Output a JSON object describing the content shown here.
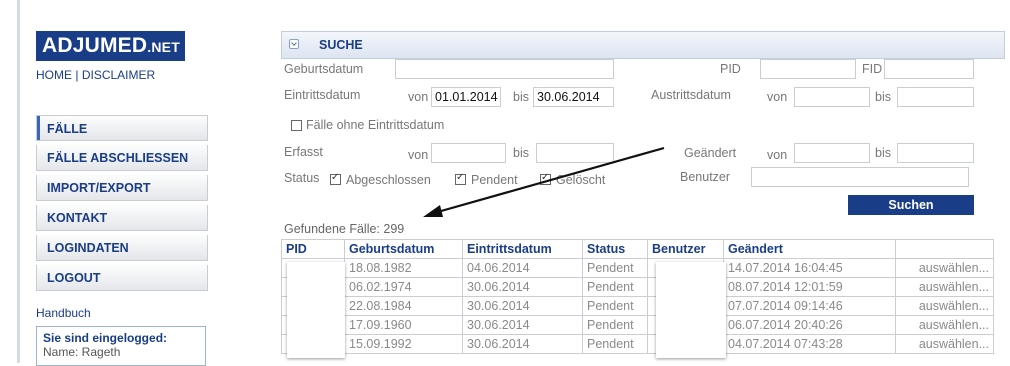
{
  "logo": {
    "main": "ADJUMED",
    "suffix": ".NET"
  },
  "toplinks": {
    "home": "HOME",
    "sep": "|",
    "disclaimer": "DISCLAIMER"
  },
  "nav": [
    "FÄLLE",
    "FÄLLE ABSCHLIESSEN",
    "IMPORT/EXPORT",
    "KONTAKT",
    "LOGINDATEN",
    "LOGOUT"
  ],
  "handbuch": "Handbuch",
  "login": {
    "title": "Sie sind eingelogged:",
    "name": "Name: Rageth"
  },
  "search": {
    "title": "SUCHE",
    "geburtsdatum_label": "Geburtsdatum",
    "pid_label": "PID",
    "fid_label": "FID",
    "eintrittsdatum_label": "Eintrittsdatum",
    "von": "von",
    "bis": "bis",
    "eintritt_von": "01.01.2014",
    "eintritt_bis": "30.06.2014",
    "austrittsdatum_label": "Austrittsdatum",
    "ohne_eintritt": "Fälle ohne Eintrittsdatum",
    "erfasst_label": "Erfasst",
    "geaendert_label": "Geändert",
    "status_label": "Status",
    "status_abgeschlossen": "Abgeschlossen",
    "status_pendent": "Pendent",
    "status_geloescht": "Gelöscht",
    "benutzer_label": "Benutzer",
    "submit": "Suchen"
  },
  "results": {
    "found_label": "Gefundene Fälle:",
    "found_count": "299",
    "headers": [
      "PID",
      "Geburtsdatum",
      "Eintrittsdatum",
      "Status",
      "Benutzer",
      "Geändert",
      ""
    ],
    "rows": [
      {
        "geburtsdatum": "18.08.1982",
        "eintritt": "04.06.2014",
        "status": "Pendent",
        "geaendert": "14.07.2014 16:04:45",
        "action": "auswählen..."
      },
      {
        "geburtsdatum": "06.02.1974",
        "eintritt": "30.06.2014",
        "status": "Pendent",
        "geaendert": "08.07.2014 12:01:59",
        "action": "auswählen..."
      },
      {
        "geburtsdatum": "22.08.1984",
        "eintritt": "30.06.2014",
        "status": "Pendent",
        "geaendert": "07.07.2014 09:14:46",
        "action": "auswählen..."
      },
      {
        "geburtsdatum": "17.09.1960",
        "eintritt": "30.06.2014",
        "status": "Pendent",
        "geaendert": "06.07.2014 20:40:26",
        "action": "auswählen..."
      },
      {
        "geburtsdatum": "15.09.1992",
        "eintritt": "30.06.2014",
        "status": "Pendent",
        "geaendert": "04.07.2014 07:43:28",
        "action": "auswählen..."
      }
    ]
  }
}
